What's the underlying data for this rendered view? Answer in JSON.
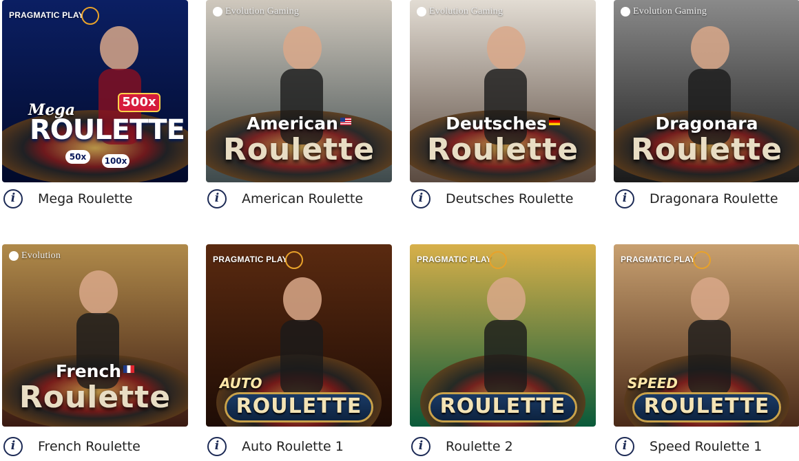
{
  "games": [
    {
      "name": "Mega Roulette",
      "provider": "PRAGMATIC PLAY",
      "provider_style": "pp",
      "art_top": "Mega",
      "art_title": "ROULETTE",
      "art_style": "mega",
      "multipliers": [
        "500x",
        "50x",
        "100x"
      ],
      "palette": {
        "bg1": "#0b1f63",
        "bg2": "#020a2a",
        "accent": "#2aa8ff"
      }
    },
    {
      "name": "American Roulette",
      "provider": "Evolution Gaming",
      "provider_style": "evo",
      "art_top": "American",
      "art_title": "Roulette",
      "art_style": "evo",
      "flag": "us",
      "palette": {
        "bg1": "#cfc8bd",
        "bg2": "#3e4a4c",
        "accent": "#3b6b3b"
      }
    },
    {
      "name": "Deutsches Roulette",
      "provider": "Evolution Gaming",
      "provider_style": "evo",
      "art_top": "Deutsches",
      "art_title": "Roulette",
      "art_style": "evo",
      "flag": "de",
      "palette": {
        "bg1": "#e2dcd3",
        "bg2": "#5a4a40",
        "accent": "#7a1f1f"
      }
    },
    {
      "name": "Dragonara Roulette",
      "provider": "Evolution Gaming",
      "provider_style": "evo",
      "art_top": "Dragonara",
      "art_title": "Roulette",
      "art_style": "evo",
      "palette": {
        "bg1": "#8a8a8a",
        "bg2": "#1a1a1a",
        "accent": "#b31b1b"
      }
    },
    {
      "name": "French Roulette",
      "provider": "Evolution",
      "provider_style": "evo",
      "art_top": "French",
      "art_title": "Roulette",
      "art_style": "evo",
      "flag": "fr",
      "palette": {
        "bg1": "#b08a4a",
        "bg2": "#3a1a12",
        "accent": "#c9a24a"
      }
    },
    {
      "name": "Auto Roulette 1",
      "provider": "PRAGMATIC PLAY",
      "provider_style": "pp",
      "art_top": "AUTO",
      "art_title": "ROULETTE",
      "art_style": "plate",
      "palette": {
        "bg1": "#5a2a10",
        "bg2": "#1e0c05",
        "accent": "#1a7a3a"
      }
    },
    {
      "name": "Roulette 2",
      "provider": "PRAGMATIC PLAY",
      "provider_style": "pp",
      "art_top": "",
      "art_title": "ROULETTE",
      "art_style": "plate",
      "palette": {
        "bg1": "#d8b04a",
        "bg2": "#0a5a3a",
        "accent": "#1a8a4a"
      }
    },
    {
      "name": "Speed Roulette 1",
      "provider": "PRAGMATIC PLAY",
      "provider_style": "pp",
      "art_top": "SPEED",
      "art_title": "ROULETTE",
      "art_style": "plate",
      "palette": {
        "bg1": "#c8a070",
        "bg2": "#4a2a18",
        "accent": "#1a7a4a"
      }
    }
  ],
  "info_icon_glyph": "i"
}
